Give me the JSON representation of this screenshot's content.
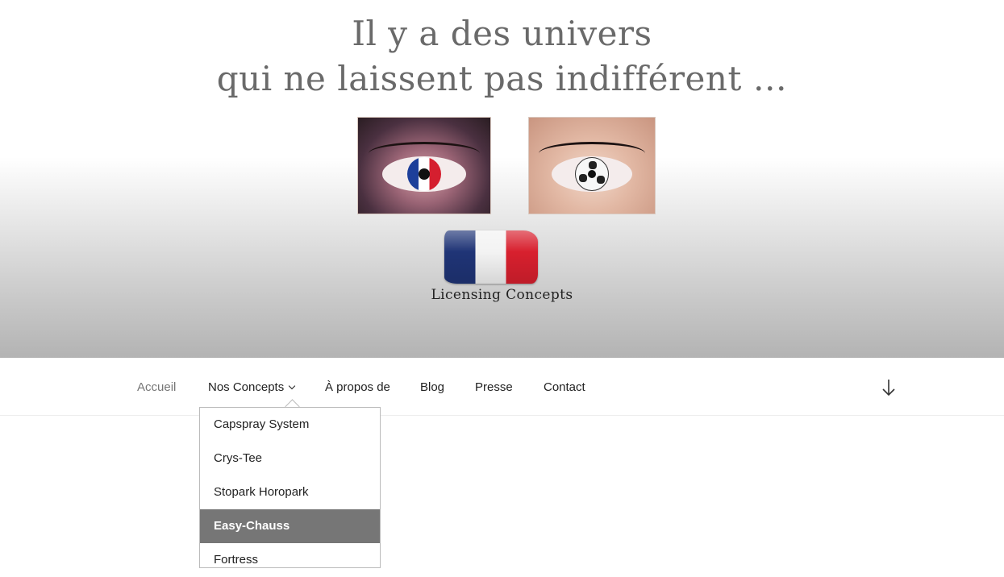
{
  "header": {
    "tagline": [
      "Il y a des univers",
      "qui ne laissent pas indifférent …"
    ],
    "logo_text": "Licensing Concepts"
  },
  "nav": {
    "items": [
      {
        "label": "Accueil",
        "current": true
      },
      {
        "label": "Nos Concepts",
        "has_submenu": true
      },
      {
        "label": "À propos de"
      },
      {
        "label": "Blog"
      },
      {
        "label": "Presse"
      },
      {
        "label": "Contact"
      }
    ],
    "scroll_icon": "arrow-down-icon"
  },
  "submenu": {
    "items": [
      {
        "label": "Capspray System"
      },
      {
        "label": "Crys-Tee"
      },
      {
        "label": "Stopark Horopark"
      },
      {
        "label": "Easy-Chauss",
        "active": true
      },
      {
        "label": "Fortress"
      }
    ]
  },
  "colors": {
    "text_dark": "#222222",
    "text_gray": "#767676",
    "highlight": "#767676"
  }
}
